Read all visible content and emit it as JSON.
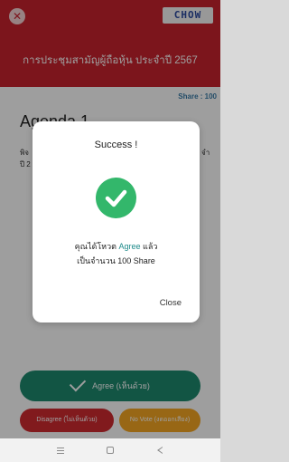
{
  "header": {
    "close_symbol": "✕",
    "logo_text": "CHOW",
    "title": "การประชุมสามัญผู้ถือหุ้น ประจำปี 2567",
    "color": "#c9232e"
  },
  "agenda": {
    "share_text": "Share : 100",
    "title": "Agenda 1",
    "text_left": [
      "พิจ",
      "ปี 2"
    ],
    "text_right": [
      "จำ",
      ""
    ]
  },
  "actions": {
    "agree_label": "Agree (เห็นด้วย)",
    "disagree_label": "Disagree (ไม่เห็นด้วย)",
    "novote_label": "No Vote (งดออกเสียง)",
    "agree_color": "#1d8a6f",
    "disagree_color": "#d12a2f",
    "novote_color": "#f5a623"
  },
  "modal": {
    "title": "Success !",
    "icon": "check-circle-icon",
    "message_prefix": "คุณได้โหวต",
    "message_choice": "Agree",
    "message_suffix": "แล้ว",
    "message_line2": "เป็นจำนวน 100 Share",
    "close_label": "Close",
    "success_color": "#33b76b"
  },
  "navbar": {
    "icons": [
      "menu-icon",
      "home-icon",
      "back-icon"
    ]
  }
}
